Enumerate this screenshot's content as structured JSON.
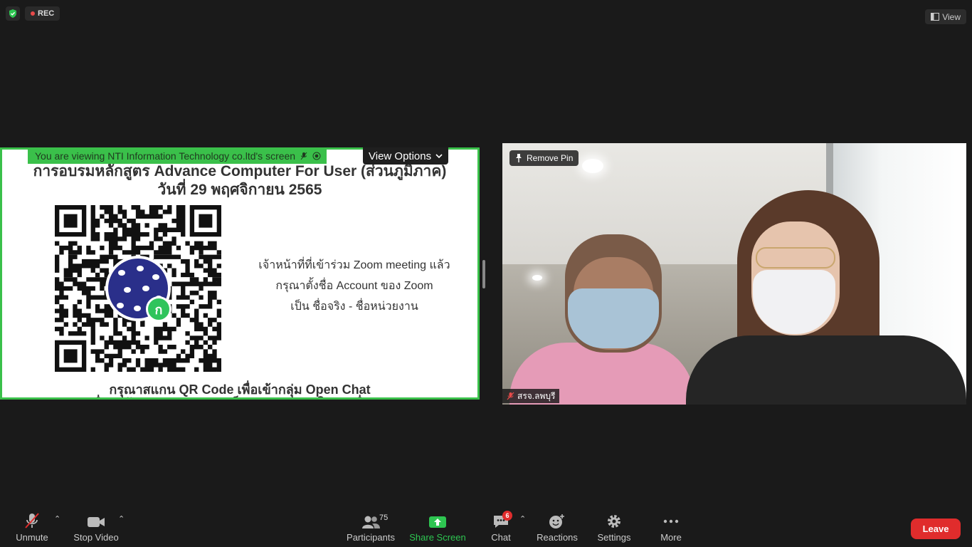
{
  "top": {
    "rec_label": "REC",
    "view_label": "View"
  },
  "share": {
    "viewing_banner": "You are viewing NTI Information Technology co.ltd's screen",
    "view_options_label": "View Options",
    "title_line1": "การอบรมหลักสูตร Advance Computer For User (ส่วนภูมิภาค)",
    "title_line2": "วันที่ 29 พฤศจิกายน 2565",
    "text_line1": "เจ้าหน้าที่ที่เข้าร่วม Zoom meeting แล้ว",
    "text_line2": "กรุณาตั้งชื่อ Account ของ Zoom",
    "text_line3": "เป็น  ชื่อจริง - ชื่อหน่วยงาน",
    "bottom_line1": "กรุณาสแกน QR Code เพื่อเข้ากลุ่ม Open Chat",
    "bottom_line2": "เพื่อรับข้อมูลข่าวสาร และเป็นช่องทางหลักในการสื่อสาร",
    "qr_badge_glyph": "ก"
  },
  "video": {
    "remove_pin_label": "Remove Pin",
    "participant_name": "สรจ.ลพบุรี"
  },
  "toolbar": {
    "unmute": "Unmute",
    "stop_video": "Stop Video",
    "participants": "Participants",
    "participants_count": "75",
    "share_screen": "Share Screen",
    "chat": "Chat",
    "chat_badge": "6",
    "reactions": "Reactions",
    "settings": "Settings",
    "more": "More",
    "leave": "Leave"
  },
  "colors": {
    "share_border": "#3ac04a",
    "leave_red": "#e02c2c",
    "share_screen_green": "#2ec551"
  }
}
